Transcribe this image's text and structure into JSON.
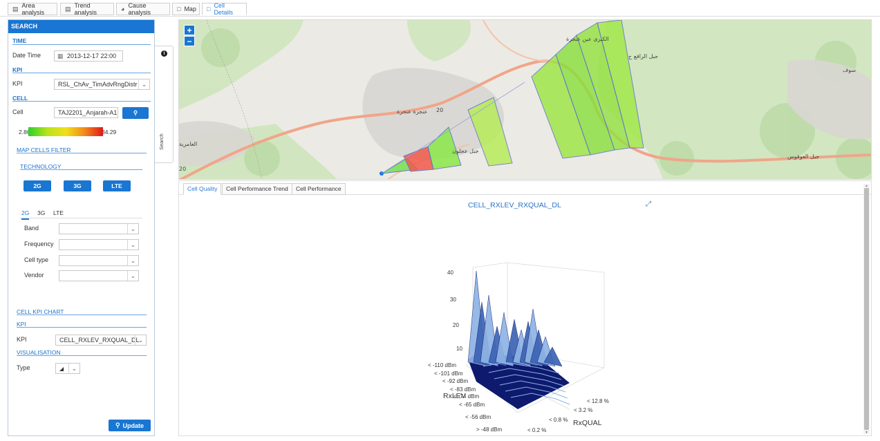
{
  "top_tabs": [
    {
      "label": "Area analysis",
      "icon": "bar-chart-icon"
    },
    {
      "label": "Trend analysis",
      "icon": "bar-chart-icon"
    },
    {
      "label": "Cause analysis",
      "icon": "pie-chart-icon"
    },
    {
      "label": "Map",
      "icon": "map-icon"
    },
    {
      "label": "Cell Details",
      "icon": "map-icon",
      "active": true
    }
  ],
  "panel": {
    "title": "SEARCH",
    "time_section": "TIME",
    "date_label": "Date Time",
    "date_value": "2013-12-17 22:00",
    "kpi_section": "KPI",
    "kpi_label": "KPI",
    "kpi_value": "RSL_ChAv_TimAdvRngDistr",
    "cell_section": "CELL",
    "cell_label": "Cell",
    "cell_value": "TAJ2201_Anjarah-A1",
    "scale_min": "2.86",
    "scale_max": "34.29",
    "filter_section": "MAP CELLS FILTER",
    "technology_section": "TECHNOLOGY",
    "tech_buttons": [
      "2G",
      "3G",
      "LTE"
    ],
    "subtabs": [
      "2G",
      "3G",
      "LTE"
    ],
    "filters": [
      {
        "label": "Band",
        "value": ""
      },
      {
        "label": "Frequency",
        "value": ""
      },
      {
        "label": "Cell type",
        "value": ""
      },
      {
        "label": "Vendor",
        "value": ""
      }
    ],
    "kpi_chart_section": "CELL KPI CHART",
    "kpi2_section": "KPI",
    "kpi2_label": "KPI",
    "kpi2_value": "CELL_RXLEV_RXQUAL_DL",
    "visualisation_section": "VISUALISATION",
    "type_label": "Type",
    "update_button": "Update"
  },
  "side_handle": {
    "label": "Search"
  },
  "map": {
    "zoom_in": "+",
    "zoom_out": "−",
    "place_labels": [
      "عنجرة عنجرة",
      "جبل عجلون",
      "العامرية",
      "سوف",
      "جبل العوفوس",
      "جبل الرافع ح",
      "20",
      "20",
      "الكبرى عين عنجرة"
    ]
  },
  "lower_tabs": [
    {
      "label": "Cell Quality",
      "active": true
    },
    {
      "label": "Cell Performance Trend"
    },
    {
      "label": "Cell Performance"
    }
  ],
  "chart_data": {
    "type": "surface3d",
    "title": "CELL_RXLEV_RXQUAL_DL",
    "zlabel_ticks": [
      "40",
      "30",
      "20",
      "10"
    ],
    "xlabel": "RxLEV",
    "x_ticks": [
      "< -110 dBm",
      "< -101 dBm",
      "< -92 dBm",
      "< -83 dBm",
      "< -74 dBm",
      "< -65 dBm",
      "< -56 dBm",
      "> -48 dBm"
    ],
    "ylabel": "RxQUAL",
    "y_ticks": [
      "< 12.8 %",
      "< 3.2 %",
      "< 0.8 %",
      "< 0.2 %"
    ],
    "zlim": [
      0,
      40
    ],
    "colors": [
      "#0d1a6e",
      "#3c64b4",
      "#8fb4e6"
    ]
  }
}
